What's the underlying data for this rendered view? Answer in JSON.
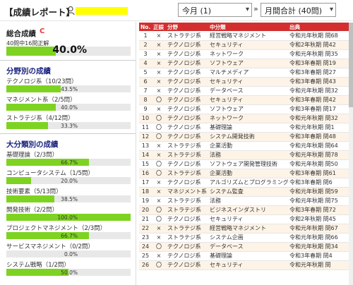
{
  "app": {
    "title": "【成績レポート】",
    "user_icon": "user-icon"
  },
  "controls": {
    "month": "今月 (1)",
    "arrow": "»",
    "total": "月間合計 (40問)"
  },
  "overall": {
    "title": "総合成績",
    "grade": "C",
    "grade_color": "#e53935",
    "sub": "40問中16問正解",
    "percent_text": "40.0%",
    "percent": 40.0
  },
  "by_field": {
    "title": "分野別の成績",
    "items": [
      {
        "label": "テクノロジ系（10/23問）",
        "pct_text": "43.5%",
        "pct": 43.5
      },
      {
        "label": "マネジメント系（2/5問）",
        "pct_text": "40.0%",
        "pct": 40.0
      },
      {
        "label": "ストラテジ系（4/12問）",
        "pct_text": "33.3%",
        "pct": 33.3
      }
    ]
  },
  "by_category": {
    "title": "大分類別の成績",
    "items": [
      {
        "label": "基礎理論（2/3問）",
        "pct_text": "66.7%",
        "pct": 66.7
      },
      {
        "label": "コンピュータシステム（1/5問）",
        "pct_text": "20.0%",
        "pct": 20.0
      },
      {
        "label": "技術要素（5/13問）",
        "pct_text": "38.5%",
        "pct": 38.5
      },
      {
        "label": "開発技術（2/2問）",
        "pct_text": "100.0%",
        "pct": 100.0
      },
      {
        "label": "プロジェクトマネジメント（2/3問）",
        "pct_text": "66.7%",
        "pct": 66.7
      },
      {
        "label": "サービスマネジメント（0/2問）",
        "pct_text": "0.0%",
        "pct": 0.0
      },
      {
        "label": "システム戦略（1/2問）",
        "pct_text": "50.0%",
        "pct": 50.0
      }
    ]
  },
  "table": {
    "headers": [
      "No.",
      "正誤",
      "分野",
      "中分類",
      "出典"
    ],
    "rows": [
      [
        "1",
        "×",
        "ストラテジ系",
        "経営戦略マネジメント",
        "令和元年秋期 問68"
      ],
      [
        "2",
        "×",
        "テクノロジ系",
        "セキュリティ",
        "令和2年秋期 問42"
      ],
      [
        "3",
        "×",
        "テクノロジ系",
        "ネットワーク",
        "令和元年秋期 問35"
      ],
      [
        "4",
        "×",
        "テクノロジ系",
        "ソフトウェア",
        "令和3年春期 問19"
      ],
      [
        "5",
        "×",
        "テクノロジ系",
        "マルチメディア",
        "令和3年春期 問27"
      ],
      [
        "6",
        "×",
        "テクノロジ系",
        "セキュリティ",
        "令和3年春期 問43"
      ],
      [
        "7",
        "×",
        "テクノロジ系",
        "データベース",
        "令和元年秋期 問32"
      ],
      [
        "8",
        "〇",
        "テクノロジ系",
        "セキュリティ",
        "令和3年春期 問42"
      ],
      [
        "9",
        "×",
        "テクノロジ系",
        "ソフトウェア",
        "令和3年春期 問17"
      ],
      [
        "10",
        "〇",
        "テクノロジ系",
        "ネットワーク",
        "令和元年秋期 問32"
      ],
      [
        "11",
        "〇",
        "テクノロジ系",
        "基礎理論",
        "令和元年秋期 問1"
      ],
      [
        "12",
        "〇",
        "テクノロジ系",
        "システム開発技術",
        "令和3年春期 問48"
      ],
      [
        "13",
        "×",
        "ストラテジ系",
        "企業活動",
        "令和元年秋期 問64"
      ],
      [
        "14",
        "×",
        "ストラテジ系",
        "法務",
        "令和元年秋期 問78"
      ],
      [
        "15",
        "〇",
        "テクノロジ系",
        "ソフトウェア開発管理技術",
        "令和元年秋期 問50"
      ],
      [
        "16",
        "〇",
        "ストラテジ系",
        "企業活動",
        "令和3年春期 問61"
      ],
      [
        "17",
        "×",
        "テクノロジ系",
        "アルゴリズムとプログラミング",
        "令和3年春期 問6"
      ],
      [
        "18",
        "×",
        "マネジメント系",
        "システム監査",
        "令和元年秋期 問59"
      ],
      [
        "19",
        "×",
        "ストラテジ系",
        "法務",
        "令和元年秋期 問75"
      ],
      [
        "20",
        "〇",
        "ストラテジ系",
        "ビジネスインダストリ",
        "令和3年春期 問72"
      ],
      [
        "21",
        "〇",
        "テクノロジ系",
        "セキュリティ",
        "令和2年秋期 問45"
      ],
      [
        "22",
        "×",
        "ストラテジ系",
        "経営戦略マネジメント",
        "令和元年秋期 問67"
      ],
      [
        "23",
        "×",
        "ストラテジ系",
        "システム企画",
        "令和元年秋期 問66"
      ],
      [
        "24",
        "〇",
        "テクノロジ系",
        "データベース",
        "令和元年秋期 問34"
      ],
      [
        "25",
        "×",
        "テクノロジ系",
        "基礎理論",
        "令和3年春期 問4"
      ],
      [
        "26",
        "〇",
        "テクノロジ系",
        "セキュリティ",
        "令和元年秋期 問"
      ]
    ]
  }
}
